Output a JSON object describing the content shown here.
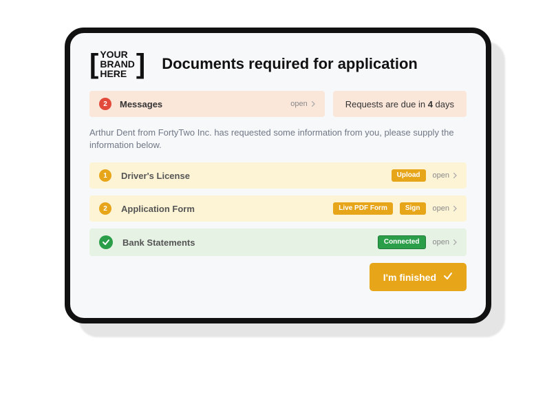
{
  "brand": {
    "line1": "YOUR",
    "line2": "BRAND",
    "line3": "HERE"
  },
  "page_title": "Documents required for application",
  "messages": {
    "count": "2",
    "label": "Messages",
    "open": "open"
  },
  "due": {
    "prefix": "Requests are due in ",
    "bold": "4",
    "suffix": " days"
  },
  "intro": "Arthur Dent from FortyTwo Inc. has requested some information from you, please supply the information below.",
  "rows": [
    {
      "badge": "1",
      "badge_kind": "amber",
      "title": "Driver's License",
      "tags": [
        "Upload"
      ],
      "open": "open",
      "status": "pending"
    },
    {
      "badge": "2",
      "badge_kind": "amber",
      "title": "Application Form",
      "tags": [
        "Live PDF Form",
        "Sign"
      ],
      "open": "open",
      "status": "pending"
    },
    {
      "badge": "check",
      "badge_kind": "check",
      "title": "Bank Statements",
      "tags": [
        "Connected"
      ],
      "open": "open",
      "status": "done"
    }
  ],
  "finish_label": "I'm finished"
}
